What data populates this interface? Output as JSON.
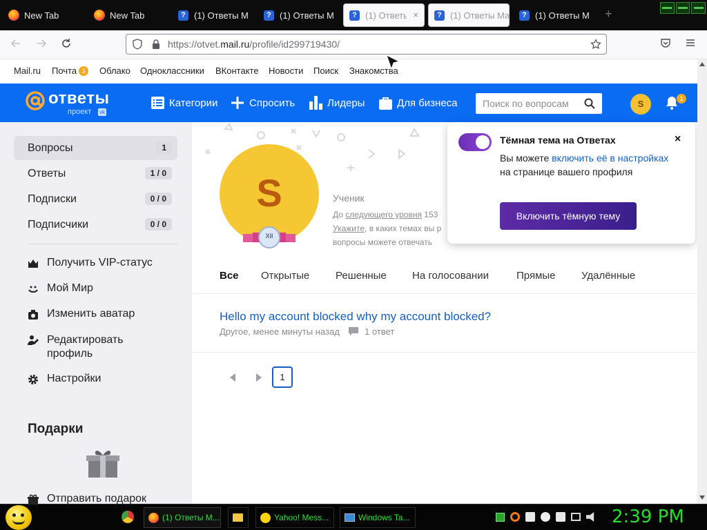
{
  "browser": {
    "tabs": [
      {
        "label": "New Tab",
        "icon": "firefox-icon",
        "active": false
      },
      {
        "label": "New Tab",
        "icon": "firefox-icon",
        "active": false
      },
      {
        "label": "(1) Ответы Ma",
        "icon": "otvety-icon",
        "active": false
      },
      {
        "label": "(1) Ответы Ma",
        "icon": "otvety-icon",
        "active": false
      },
      {
        "label": "(1) Ответы",
        "icon": "otvety-icon",
        "active": true
      },
      {
        "label": "(1) Ответы Ma",
        "icon": "otvety-icon",
        "active": true
      },
      {
        "label": "(1) Ответы Ma",
        "icon": "otvety-icon",
        "active": false
      }
    ],
    "tab_close": "×",
    "new_tab": "+",
    "url_prefix": "https://otvet.",
    "url_domain": "mail.ru",
    "url_path": "/profile/id299719430/"
  },
  "bookmarks": {
    "items": [
      "Mail.ru",
      "Почта",
      "Облако",
      "Одноклассники",
      "ВКонтакте",
      "Новости",
      "Поиск",
      "Знакомства"
    ],
    "mail_badge": "3",
    "avatar_letter": "S"
  },
  "header": {
    "logo": "ответы",
    "logo_sub": "проект",
    "logo_vk": "vk",
    "nav": [
      "Категории",
      "Спросить",
      "Лидеры",
      "Для бизнеса"
    ],
    "search_placeholder": "Поиск по вопросам",
    "avatar_letter": "S",
    "notif_count": "1"
  },
  "sidebar": {
    "stats": [
      {
        "label": "Вопросы",
        "count": "1"
      },
      {
        "label": "Ответы",
        "count": "1 / 0"
      },
      {
        "label": "Подписки",
        "count": "0 / 0"
      },
      {
        "label": "Подписчики",
        "count": "0 / 0"
      }
    ],
    "links": [
      "Получить VIP-статус",
      "Мой Мир",
      "Изменить аватар",
      "Редактировать профиль",
      "Настройки"
    ],
    "gifts_title": "Подарки",
    "send_gift": "Отправить подарок"
  },
  "profile": {
    "avatar_letter": "S",
    "level_badge": "XII",
    "rank": "Ученик",
    "line1_pre": "До ",
    "line1_link": "следующего уровня",
    "line1_num": " 153",
    "line2_link": "Укажите",
    "line2_rest": ", в каких темах вы р",
    "line3": "вопросы можете отвечать",
    "tabs": [
      "Все",
      "Открытые",
      "Решенные",
      "На голосовании",
      "Прямые",
      "Удалённые"
    ]
  },
  "question": {
    "title": "Hello my account blocked why my account blocked?",
    "meta": "Другое, менее минуты назад",
    "answers": "1 ответ"
  },
  "pagination": {
    "current": "1"
  },
  "popup": {
    "title": "Тёмная тема на Ответах",
    "text_1": "Вы можете ",
    "text_link": "включить её в настройках",
    "text_2": " на странице вашего профиля",
    "button": "Включить тёмную тему",
    "close": "×"
  },
  "taskbar": {
    "items": [
      {
        "label": "(1) Ответы M...",
        "icon": "firefox-icon"
      },
      {
        "label": "",
        "icon": "folder-icon"
      },
      {
        "label": "Yahoo! Mess...",
        "icon": "yahoo-messenger-icon"
      },
      {
        "label": "Windows Ta...",
        "icon": "task-manager-icon"
      }
    ],
    "clock": "2:39 PM"
  }
}
